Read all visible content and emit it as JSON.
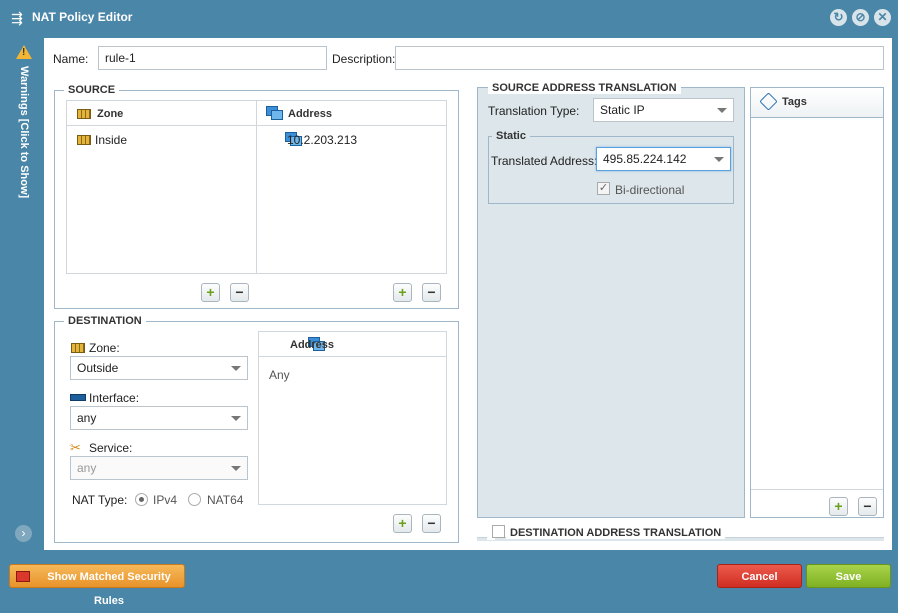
{
  "window": {
    "title": "NAT Policy Editor"
  },
  "warnings_tab": {
    "label": "Warnings [Click to Show]"
  },
  "rule": {
    "name_label": "Name:",
    "name_value": "rule-1",
    "description_label": "Description:",
    "description_value": ""
  },
  "source": {
    "title": "SOURCE",
    "zone_header": "Zone",
    "address_header": "Address",
    "zones": [
      "Inside"
    ],
    "addresses": [
      "10.2.203.213"
    ]
  },
  "destination": {
    "title": "DESTINATION",
    "zone_label": "Zone:",
    "zone_value": "Outside",
    "interface_label": "Interface:",
    "interface_value": "any",
    "service_label": "Service:",
    "service_value": "any",
    "nat_type_label": "NAT Type:",
    "nat_types": [
      "IPv4",
      "NAT64"
    ],
    "nat_type_selected": "IPv4",
    "address_header": "Address",
    "address_value": "Any"
  },
  "source_translation": {
    "title": "SOURCE ADDRESS TRANSLATION",
    "type_label": "Translation Type:",
    "type_value": "Static IP",
    "static_group_title": "Static",
    "translated_label": "Translated Address:",
    "translated_value": "495.85.224.142",
    "bidirectional_label": "Bi-directional",
    "bidirectional_checked": true
  },
  "destination_translation": {
    "title": "DESTINATION ADDRESS TRANSLATION",
    "checked": false
  },
  "tags": {
    "title": "Tags"
  },
  "footer": {
    "show_rules_label": "Show Matched Security Rules",
    "cancel_label": "Cancel",
    "save_label": "Save"
  },
  "colors": {
    "frame": "#4a86a8",
    "cancel": "#d9382b",
    "save": "#8fbe2c",
    "show_rules": "#f0a33a"
  }
}
